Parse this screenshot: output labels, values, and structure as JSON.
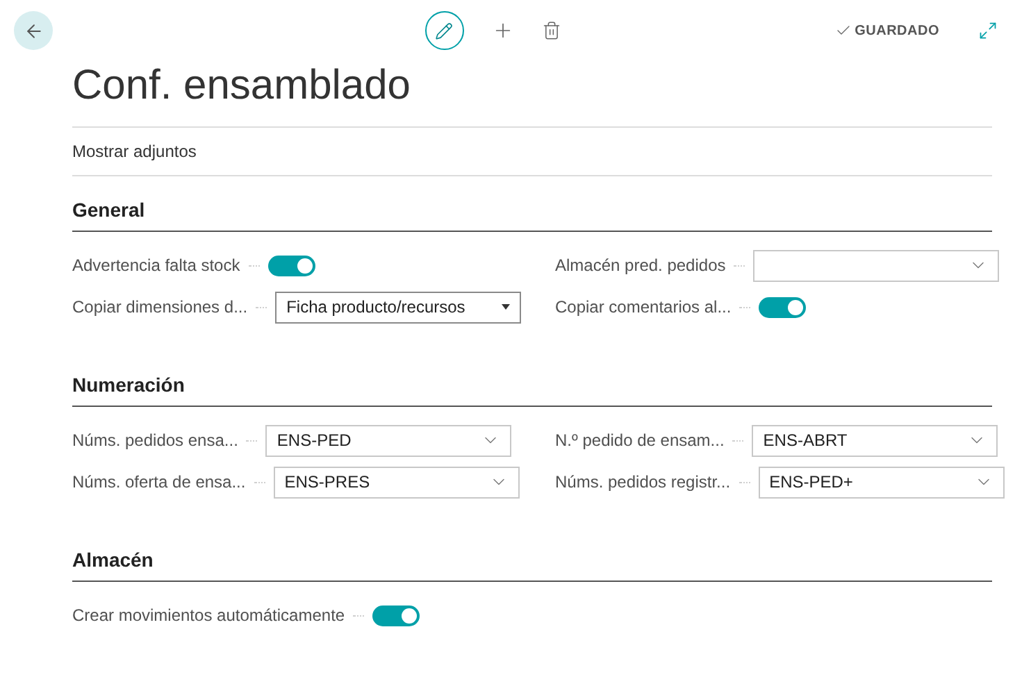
{
  "toolbar": {
    "status": "GUARDADO"
  },
  "title": "Conf. ensamblado",
  "actions": [
    "Mostrar adjuntos"
  ],
  "sections": [
    {
      "title": "General",
      "fields": [
        {
          "label": "Advertencia falta stock",
          "kind": "toggle",
          "on": true
        },
        {
          "label": "Almacén pred. pedidos",
          "kind": "combo"
        },
        {
          "label": "Copiar dimensiones d...",
          "kind": "select",
          "value": "Ficha producto/recursos"
        },
        {
          "label": "Copiar comentarios al...",
          "kind": "toggle",
          "on": true
        }
      ]
    },
    {
      "title": "Numeración",
      "fields": [
        {
          "label": "Núms. pedidos ensa...",
          "kind": "combo",
          "value": "ENS-PED"
        },
        {
          "label": "N.º pedido de ensam...",
          "kind": "combo",
          "value": "ENS-ABRT"
        },
        {
          "label": "Núms. oferta de ensa...",
          "kind": "combo",
          "value": "ENS-PRES"
        },
        {
          "label": "Núms. pedidos registr...",
          "kind": "combo",
          "value": "ENS-PED+"
        }
      ]
    },
    {
      "title": "Almacén",
      "fields": [
        {
          "label": "Crear movimientos automáticamente",
          "kind": "toggle",
          "on": true
        }
      ]
    }
  ]
}
